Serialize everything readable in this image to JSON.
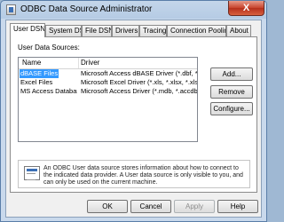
{
  "window": {
    "title": "ODBC Data Source Administrator",
    "close_symbol": "X"
  },
  "tabs": [
    "User DSN",
    "System DSN",
    "File DSN",
    "Drivers",
    "Tracing",
    "Connection Pooling",
    "About"
  ],
  "active_tab": "User DSN",
  "user_dsn": {
    "section_label": "User Data Sources:",
    "columns": [
      "Name",
      "Driver"
    ],
    "rows": [
      {
        "name": "dBASE Files",
        "driver": "Microsoft Access dBASE Driver (*.dbf, *.ndx",
        "selected": true
      },
      {
        "name": "Excel Files",
        "driver": "Microsoft Excel Driver (*.xls, *.xlsx, *.xlsm, *.x",
        "selected": false
      },
      {
        "name": "MS Access Database",
        "driver": "Microsoft Access Driver (*.mdb, *.accdb)",
        "selected": false
      }
    ],
    "buttons": {
      "add": "Add...",
      "remove": "Remove",
      "configure": "Configure..."
    },
    "info_text": "An ODBC User data source stores information about how to connect to the indicated data provider.   A User data source is only visible to you, and can only be used on the current machine."
  },
  "footer_buttons": {
    "ok": "OK",
    "cancel": "Cancel",
    "apply": "Apply",
    "help": "Help"
  },
  "colors": {
    "selection": "#3399ff",
    "close_button": "#c7432c",
    "title_bar": "#b5cbe4"
  }
}
